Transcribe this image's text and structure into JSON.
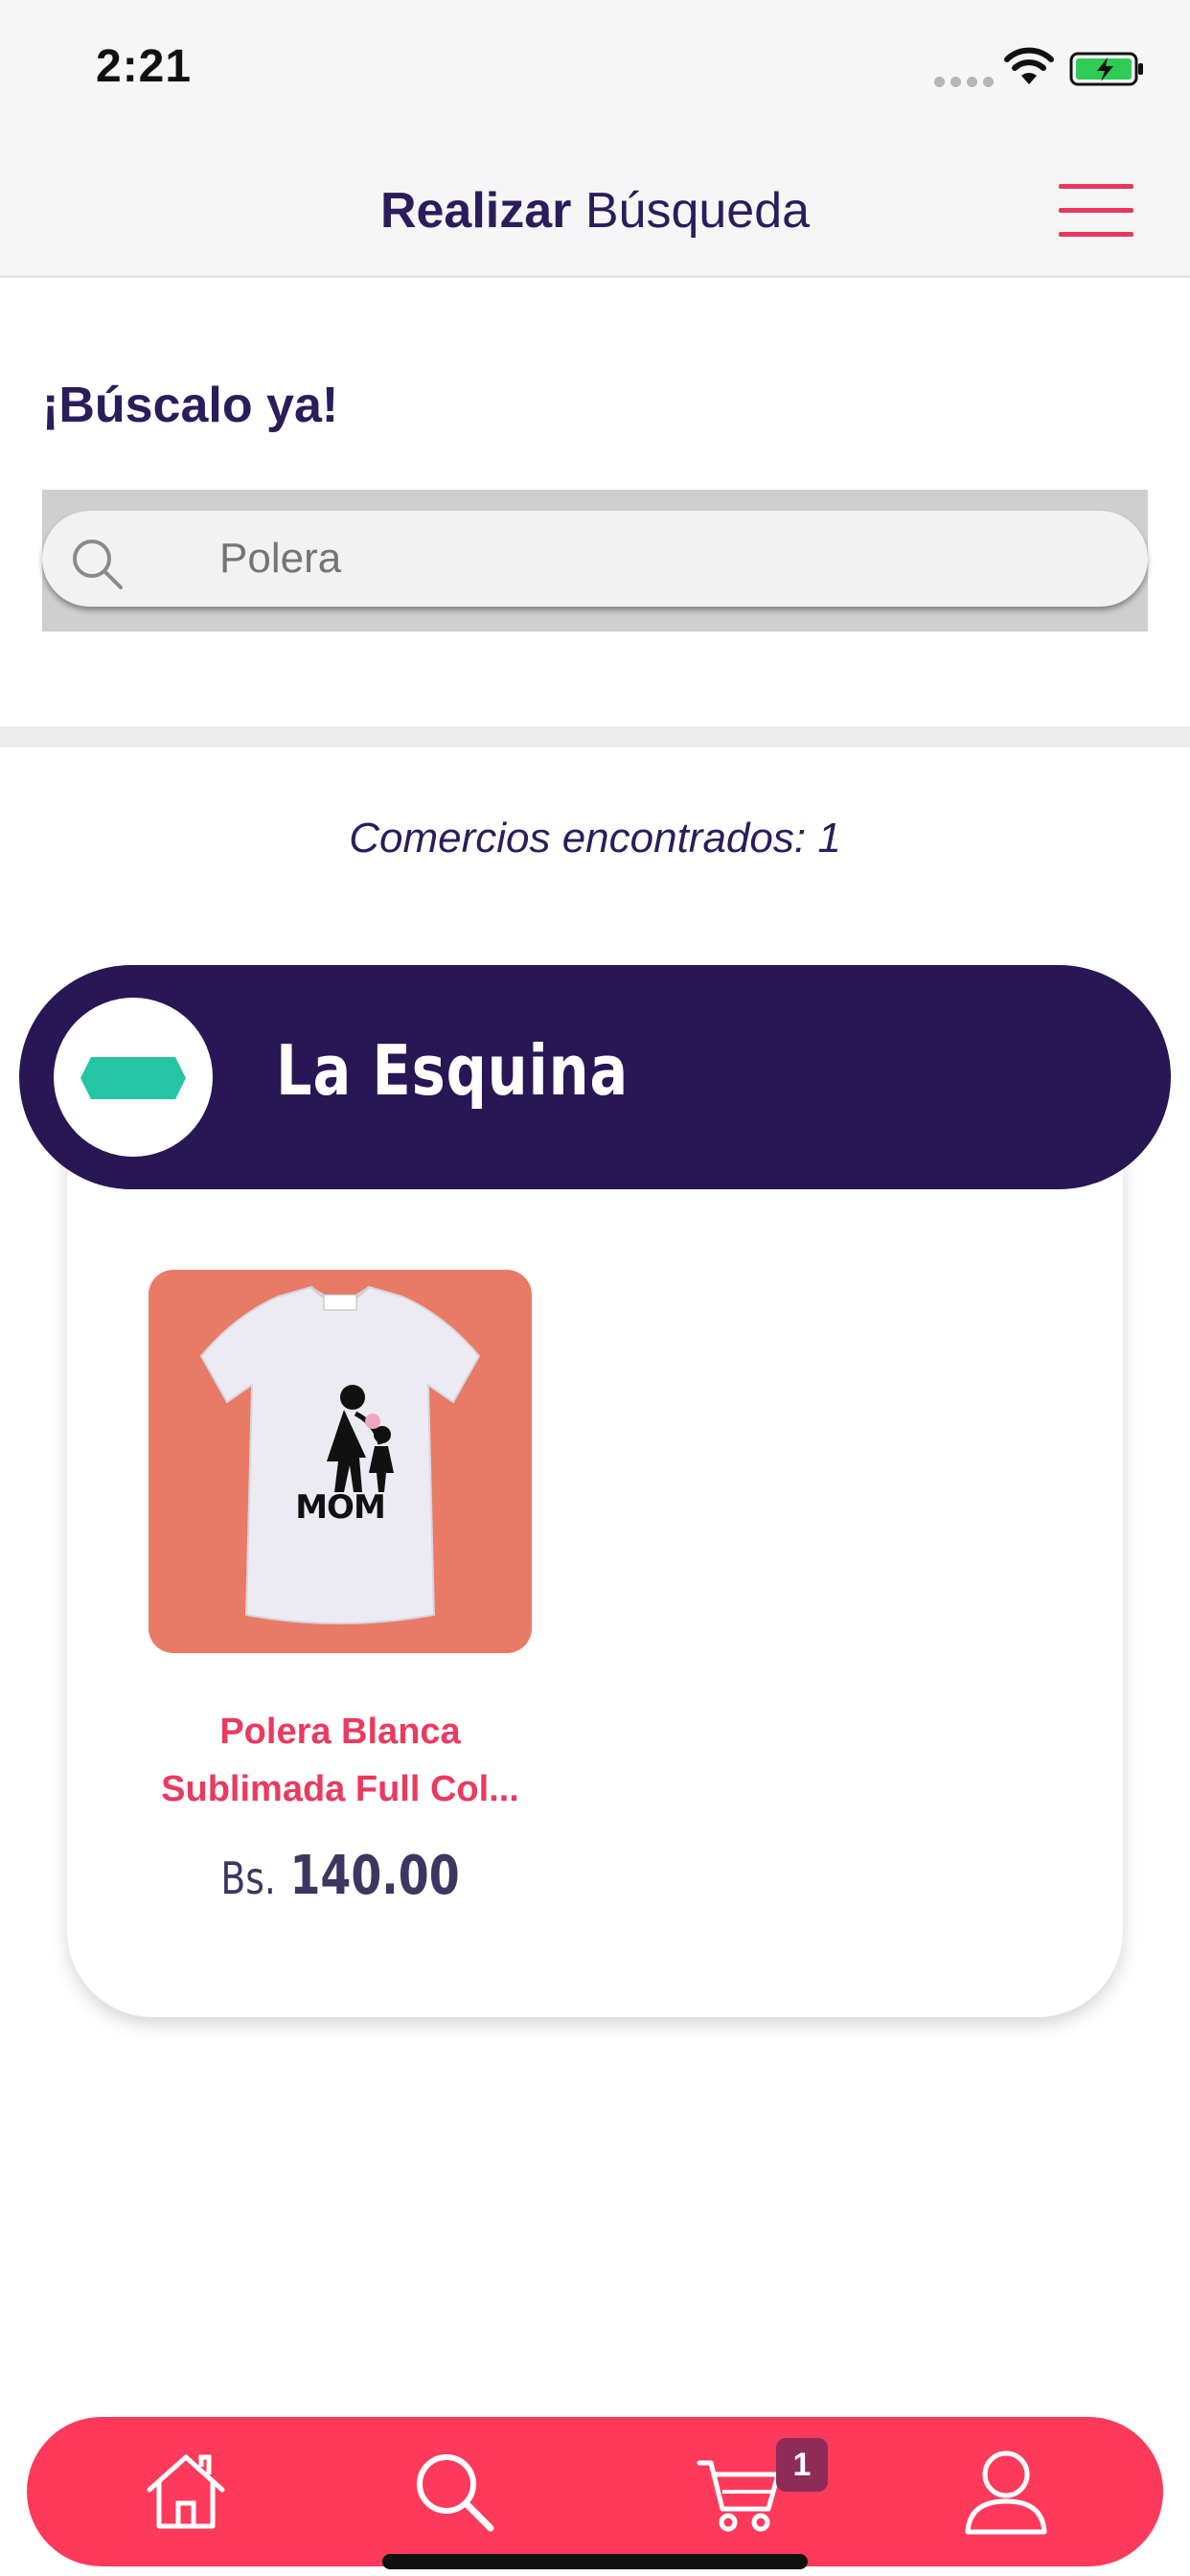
{
  "status_bar": {
    "time": "2:21"
  },
  "header": {
    "title_bold": "Realizar",
    "title_rest": " Búsqueda"
  },
  "search": {
    "heading": "¡Búscalo ya!",
    "placeholder": "Polera"
  },
  "results": {
    "count_text": "Comercios encontrados: 1"
  },
  "store": {
    "name": "La Esquina",
    "products": [
      {
        "name_line1": "Polera Blanca",
        "name_line2": "Sublimada Full Col...",
        "currency": "Bs.",
        "price": "140.00",
        "image_text": "MOM"
      }
    ]
  },
  "tab_bar": {
    "cart_badge": "1"
  },
  "colors": {
    "brand_dark": "#281655",
    "accent": "#fe3a5c",
    "product_name": "#ea3a5f",
    "badge": "#8e2c58"
  }
}
